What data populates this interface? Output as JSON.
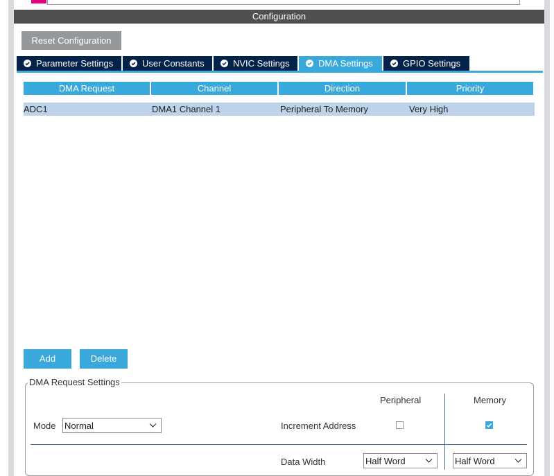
{
  "header": {
    "title": "Configuration"
  },
  "toolbar": {
    "reset_label": "Reset Configuration"
  },
  "tabs": [
    {
      "label": "Parameter Settings",
      "active": false
    },
    {
      "label": "User Constants",
      "active": false
    },
    {
      "label": "NVIC Settings",
      "active": false
    },
    {
      "label": "DMA Settings",
      "active": true
    },
    {
      "label": "GPIO Settings",
      "active": false
    }
  ],
  "table": {
    "columns": [
      "DMA Request",
      "Channel",
      "Direction",
      "Priority"
    ],
    "rows": [
      [
        "ADC1",
        "DMA1 Channel 1",
        "Peripheral To Memory",
        "Very High"
      ]
    ]
  },
  "actions": {
    "add_label": "Add",
    "delete_label": "Delete"
  },
  "settings": {
    "legend": "DMA Request Settings",
    "peripheral_header": "Peripheral",
    "memory_header": "Memory",
    "mode_label": "Mode",
    "mode_value": "Normal",
    "increment_label": "Increment Address",
    "peripheral_increment": false,
    "memory_increment": true,
    "data_width_label": "Data Width",
    "peripheral_width": "Half Word",
    "memory_width": "Half Word"
  },
  "colors": {
    "accent": "#39a9dc",
    "tab_bg": "#03234b",
    "header_bar": "#505050",
    "brand": "#e6007e"
  },
  "icons": [
    "check-circle-icon",
    "chevron-down-icon",
    "checkmark-icon"
  ]
}
